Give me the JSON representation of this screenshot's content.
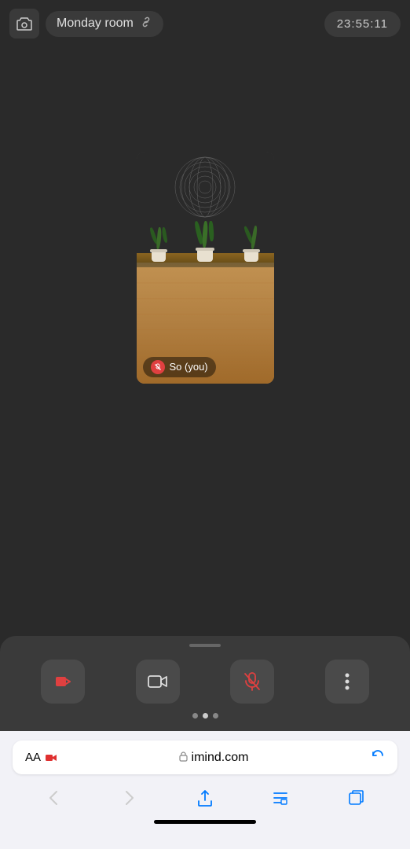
{
  "topBar": {
    "roomName": "Monday room",
    "timer": "23:55:11",
    "cameraIconSymbol": "📷",
    "linkIconSymbol": "🔗"
  },
  "video": {
    "userLabel": "So  (you)",
    "muteSymbol": "🎤"
  },
  "toolbar": {
    "buttons": [
      {
        "id": "leave",
        "symbol": "🚪",
        "label": "Leave"
      },
      {
        "id": "camera",
        "symbol": "📷",
        "label": "Camera"
      },
      {
        "id": "mute",
        "symbol": "🎤",
        "label": "Mute"
      },
      {
        "id": "more",
        "symbol": "⋮",
        "label": "More"
      }
    ],
    "dots": [
      {
        "active": false
      },
      {
        "active": true
      },
      {
        "active": false
      }
    ]
  },
  "browser": {
    "aaLabel": "AA",
    "urlDomain": "imind.com",
    "lockSymbol": "🔒",
    "reloadSymbol": "↻",
    "navBack": "‹",
    "navForward": "›",
    "navShare": "↑",
    "navBookmarks": "📖",
    "navTabs": "⧉"
  }
}
